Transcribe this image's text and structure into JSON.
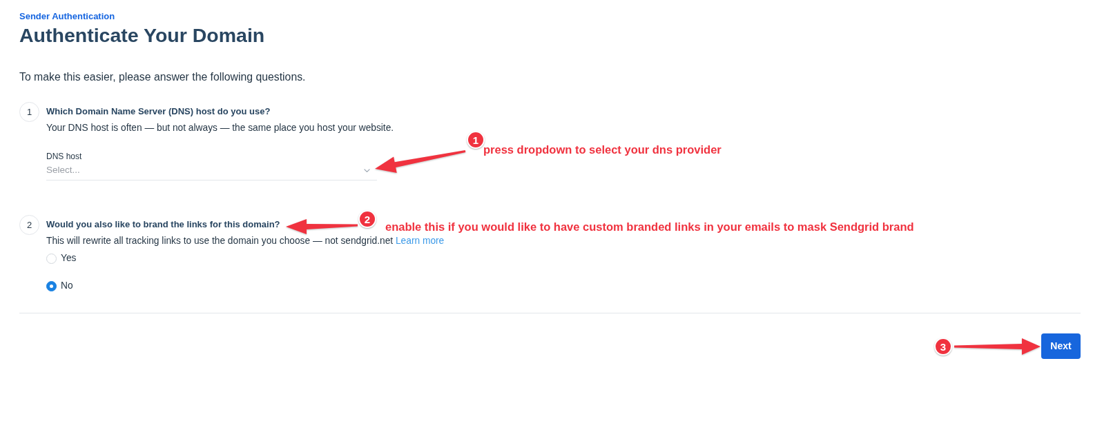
{
  "breadcrumb": "Sender Authentication",
  "title": "Authenticate Your Domain",
  "intro": "To make this easier, please answer the following questions.",
  "steps": [
    {
      "number": "1",
      "kind": "select",
      "question": "Which Domain Name Server (DNS) host do you use?",
      "description": "Your DNS host is often — but not always — the same place you host your website.",
      "field": {
        "label": "DNS host",
        "placeholder": "Select..."
      }
    },
    {
      "number": "2",
      "kind": "radio",
      "question": "Would you also like to brand the links for this domain?",
      "description": "This will rewrite all tracking links to use the domain you choose — not sendgrid.net",
      "link": "Learn more",
      "options": [
        {
          "label": "Yes",
          "selected": false
        },
        {
          "label": "No",
          "selected": true
        }
      ]
    }
  ],
  "actions": {
    "next": "Next"
  },
  "annotations": [
    {
      "number": "1",
      "note": "press dropdown to select your dns provider"
    },
    {
      "number": "2",
      "note": "enable this if you would like to have custom branded links in your emails to mask Sendgrid brand"
    },
    {
      "number": "3"
    }
  ]
}
